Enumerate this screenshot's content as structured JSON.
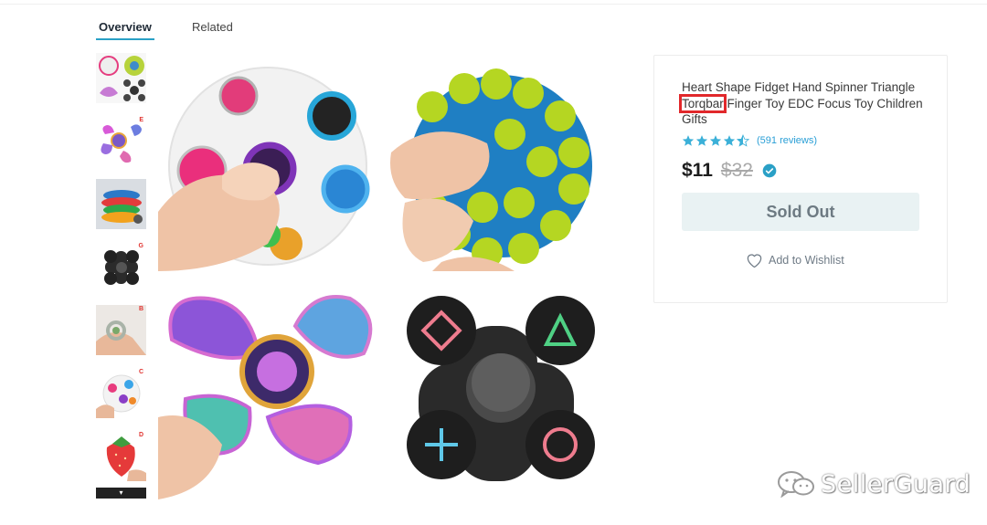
{
  "tabs": {
    "overview": "Overview",
    "related": "Related"
  },
  "thumbnails": [
    {
      "letter": "",
      "subject": "collage of fidget toys"
    },
    {
      "letter": "E",
      "subject": "heart fidget spinner"
    },
    {
      "letter": "",
      "subject": "fidget spinners stack"
    },
    {
      "letter": "G",
      "subject": "controller fidget spinner"
    },
    {
      "letter": "B",
      "subject": "fidget ring in hand"
    },
    {
      "letter": "C",
      "subject": "rainbow puzzle ball"
    },
    {
      "letter": "D",
      "subject": "squishy strawberry"
    }
  ],
  "thumbnails_more_icon": "▾",
  "product": {
    "title_before": "Heart Shape Fidget Hand Spinner Triangle ",
    "title_highlight": "Torqbar",
    "title_after": " Finger Toy EDC Focus Toy Children Gifts",
    "rating": 4.5,
    "reviews": "(591 reviews)",
    "price": "$11",
    "old_price": "$32",
    "sold_out_label": "Sold Out",
    "wishlist_label": "Add to Wishlist"
  },
  "colors": {
    "accent": "#2aa0c6",
    "star": "#3bb0d8",
    "highlight_box": "#e1282b",
    "sold_out_bg": "#e9f2f3"
  },
  "watermark": {
    "text": "SellerGuard"
  }
}
